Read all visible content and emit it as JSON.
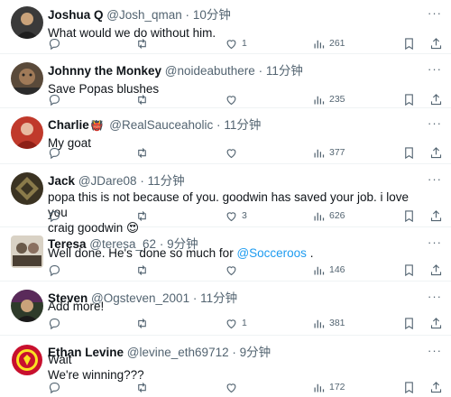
{
  "tweets": [
    {
      "name": "Joshua Q",
      "handle": "@Josh_qman",
      "sep": "·",
      "time": "10分钟",
      "lines": [
        "What would we do without him."
      ],
      "likes": "1",
      "views": "261",
      "avatar_color": "#3a3a3a"
    },
    {
      "name": "Johnny the Monkey",
      "handle": "@noideabuthere",
      "sep": "·",
      "time": "11分钟",
      "lines": [
        "Save Popas blushes"
      ],
      "likes": "",
      "views": "235",
      "avatar_color": "#5a4a3a"
    },
    {
      "name": "Charlie",
      "badge": "👹",
      "handle": "@RealSauceaholic",
      "sep": "·",
      "time": "11分钟",
      "lines": [
        "My goat"
      ],
      "likes": "",
      "views": "377",
      "avatar_color": "#c0392b"
    },
    {
      "name": "Jack",
      "handle": "@JDare08",
      "sep": "·",
      "time": "11分钟",
      "lines": [
        "popa this is not because of you. goodwin has saved your job. i love you",
        "craig goodwin 😍"
      ],
      "likes": "3",
      "views": "626",
      "avatar_color": "#8a7a4a"
    },
    {
      "name": "Teresa",
      "handle": "@teresa_62",
      "sep": "·",
      "time": "9分钟",
      "text_before": "Well done. He's  done so much for ",
      "mention": "@Socceroos",
      "text_after": " .",
      "likes": "",
      "views": "146",
      "avatar_color": "#6a5a4a"
    },
    {
      "name": "Steven",
      "handle": "@Ogsteven_2001",
      "sep": "·",
      "time": "11分钟",
      "lines": [
        "Add more!"
      ],
      "likes": "1",
      "views": "381",
      "avatar_color": "#2e3b2a"
    },
    {
      "name": "Ethan Levine",
      "handle": "@levine_eth69712",
      "sep": "·",
      "time": "9分钟",
      "lines": [
        "Wait",
        "We're winning???"
      ],
      "likes": "",
      "views": "172",
      "avatar_color": "#c8102e"
    }
  ],
  "colors": {
    "text": "#0f1419",
    "muted": "#536471",
    "link": "#1d9bf0",
    "divider": "#eff3f4"
  },
  "icons": {
    "more": "more-horizontal-icon",
    "reply": "reply-icon",
    "retweet": "retweet-icon",
    "like": "heart-icon",
    "views": "views-bar-chart-icon",
    "bookmark": "bookmark-icon",
    "share": "share-icon"
  }
}
